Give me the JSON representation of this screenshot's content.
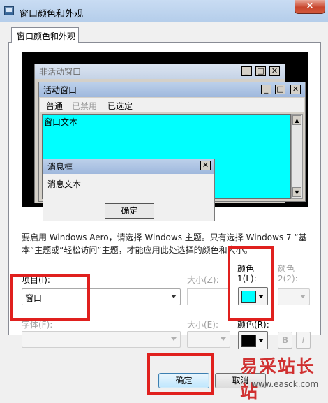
{
  "window": {
    "title": "窗口颜色和外观",
    "close_glyph": "✕"
  },
  "tab": {
    "label": "窗口颜色和外观"
  },
  "preview": {
    "inactive_title": "非活动窗口",
    "active_title": "活动窗口",
    "menus": [
      "普通",
      "已禁用",
      "已选定"
    ],
    "window_text": "窗口文本",
    "msgbox_title": "消息框",
    "msgbox_text": "消息文本",
    "msgbox_ok": "确定",
    "btn_min": "_",
    "btn_max": "□",
    "btn_close": "✕"
  },
  "description": "要启用 Windows Aero，请选择 Windows 主题。只有选择 Windows 7 “基本”主题或“轻松访问”主题，才能应用此处选择的颜色和大小。",
  "item": {
    "label": "项目(I):",
    "value": "窗口"
  },
  "size1": {
    "label": "大小(Z):"
  },
  "color1": {
    "label_line1": "颜色",
    "label_line2": "1(L):",
    "value_color": "#00ffff"
  },
  "color2": {
    "label_line1": "颜色",
    "label_line2": "2(2):"
  },
  "font": {
    "label": "字体(F):"
  },
  "size2": {
    "label": "大小(E):"
  },
  "font_color": {
    "label": "颜色(R):",
    "value_color": "#000000"
  },
  "bold_label": "B",
  "italic_label": "I",
  "ok_button": "确定",
  "cancel_button": "取消",
  "watermark": {
    "cn": "易采站长站",
    "url": "www.easck.com"
  },
  "colors": {
    "accent": "#00ffff",
    "annotation_red": "#e0201e"
  }
}
